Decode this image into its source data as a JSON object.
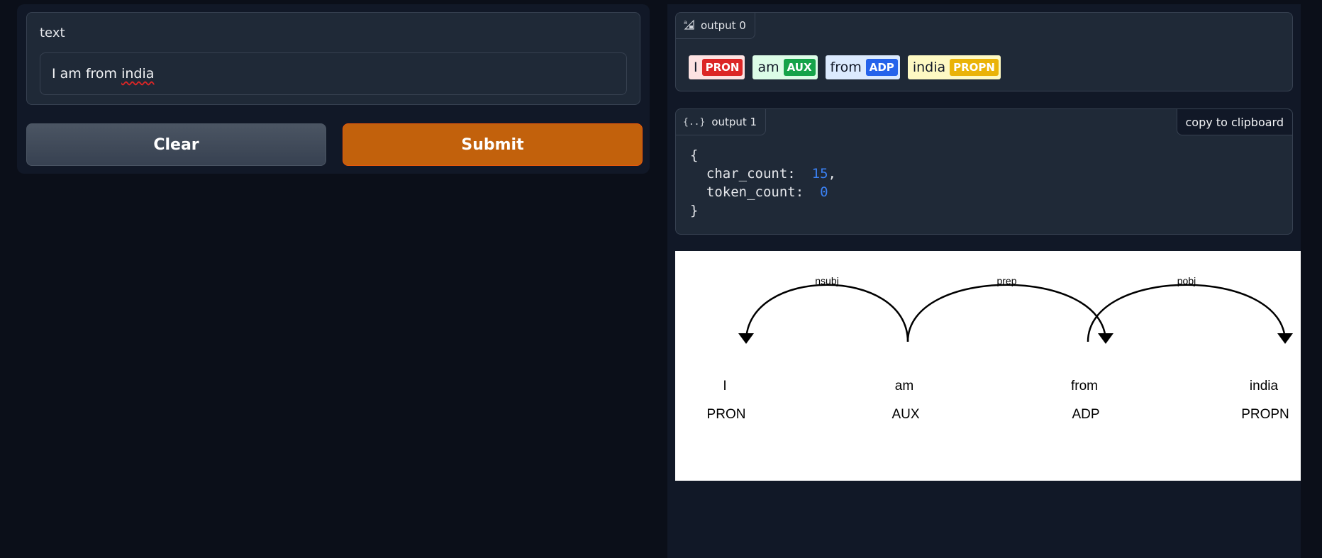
{
  "input": {
    "label": "text",
    "value_plain": "I am from ",
    "value_misspelled": "india"
  },
  "buttons": {
    "clear": "Clear",
    "submit": "Submit"
  },
  "output0": {
    "tag": "output 0",
    "icon": "highlighted-text-icon",
    "tokens": [
      {
        "text": "I",
        "pos": "PRON",
        "bg": "#fde2e2",
        "pos_color": "#dc2626"
      },
      {
        "text": "am",
        "pos": "AUX",
        "bg": "#dcfce7",
        "pos_color": "#16a34a"
      },
      {
        "text": "from",
        "pos": "ADP",
        "bg": "#dbeafe",
        "pos_color": "#2563eb"
      },
      {
        "text": "india",
        "pos": "PROPN",
        "bg": "#fef9c3",
        "pos_color": "#eab308"
      }
    ]
  },
  "output1": {
    "tag": "output 1",
    "icon": "json-braces-icon",
    "copy_label": "copy to clipboard",
    "open_brace": "{",
    "close_brace": "}",
    "char_count_key": "char_count:",
    "char_count": "15",
    "token_count_key": "token_count:",
    "token_count": "0"
  },
  "dependency": {
    "words": [
      {
        "text": "I",
        "tag": "PRON"
      },
      {
        "text": "am",
        "tag": "AUX"
      },
      {
        "text": "from",
        "tag": "ADP"
      },
      {
        "text": "india",
        "tag": "PROPN"
      }
    ],
    "arcs": [
      {
        "label": "nsubj",
        "from": 1,
        "to": 0,
        "dir": "left"
      },
      {
        "label": "prep",
        "from": 1,
        "to": 2,
        "dir": "right"
      },
      {
        "label": "pobj",
        "from": 2,
        "to": 3,
        "dir": "right"
      }
    ]
  }
}
